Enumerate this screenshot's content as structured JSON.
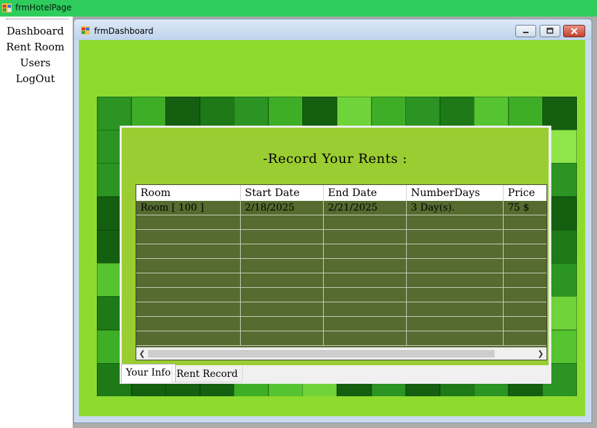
{
  "app": {
    "title": "frmHotelPage",
    "icon": "app-window-icon"
  },
  "menu": {
    "items": [
      {
        "label": "Dashboard"
      },
      {
        "label": "Rent Room"
      },
      {
        "label": "Users"
      },
      {
        "label": "LogOut"
      }
    ]
  },
  "child_window": {
    "title": "frmDashboard",
    "icon": "form-window-icon",
    "buttons": [
      "minimize-icon",
      "maximize-icon",
      "close-icon"
    ]
  },
  "rents": {
    "heading": "-Record Your Rents :",
    "columns": [
      "Room",
      "Start Date",
      "End Date",
      "NumberDays",
      "Price"
    ],
    "rows": [
      [
        "Room [ 100 ]",
        "2/18/2025",
        "2/21/2025",
        "3 Day(s).",
        "75 $"
      ]
    ]
  },
  "tabs": [
    {
      "label": "Your Info",
      "active": true
    },
    {
      "label": "Rent Record",
      "active": false
    }
  ],
  "colors": {
    "titlebar": "#2ecc5c",
    "client_bg": "#8edb2f",
    "panel_bg": "#9acd32",
    "grid_bg": "#556b2f"
  }
}
